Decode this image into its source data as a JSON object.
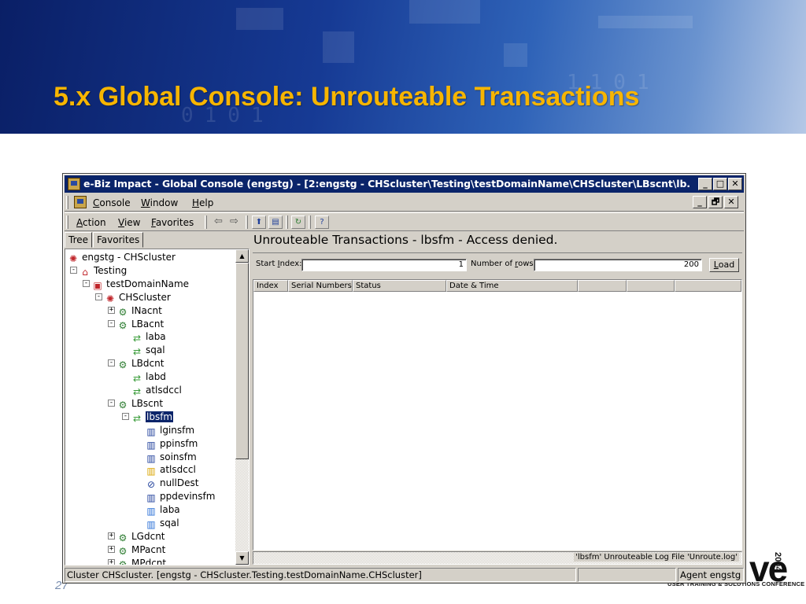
{
  "slide": {
    "title": "5.x Global Console: Unrouteable Transactions",
    "page_number": "27",
    "brand": {
      "mark": "ve",
      "year": "2004",
      "tagline": "USER TRAINING & SOLUTIONS CONFERENCE"
    }
  },
  "window": {
    "title": "e-Biz Impact - Global Console (engstg) - [2:engstg - CHScluster\\Testing\\testDomainName\\CHScluster\\LBscnt\\lb...",
    "controls": {
      "minimize": "_",
      "maximize": "□",
      "close": "✕"
    },
    "child_controls": {
      "minimize": "_",
      "restore": "🗗",
      "close": "✕"
    }
  },
  "menubar": {
    "items": [
      {
        "pre": "",
        "key": "C",
        "post": "onsole"
      },
      {
        "pre": "",
        "key": "W",
        "post": "indow"
      },
      {
        "pre": "",
        "key": "H",
        "post": "elp"
      }
    ]
  },
  "toolbar": {
    "items": [
      {
        "pre": "",
        "key": "A",
        "post": "ction"
      },
      {
        "pre": "",
        "key": "V",
        "post": "iew"
      },
      {
        "pre": "",
        "key": "F",
        "post": "avorites"
      }
    ],
    "back_glyph": "⇦",
    "forward_glyph": "⇨"
  },
  "left_tabs": [
    "Tree",
    "Favorites"
  ],
  "tree": [
    {
      "label": "engstg - CHScluster",
      "icon": "cluster-root-icon",
      "color": "#c0262b",
      "depth": 0,
      "exp": ""
    },
    {
      "label": "Testing",
      "icon": "folder-home-icon",
      "color": "#c0262b",
      "depth": 1,
      "exp": "-"
    },
    {
      "label": "testDomainName",
      "icon": "domain-icon",
      "color": "#c0262b",
      "depth": 2,
      "exp": "-"
    },
    {
      "label": "CHScluster",
      "icon": "cluster-icon",
      "color": "#c0262b",
      "depth": 3,
      "exp": "-"
    },
    {
      "label": "INacnt",
      "icon": "connector-icon",
      "color": "#2e7d32",
      "depth": 4,
      "exp": "+"
    },
    {
      "label": "LBacnt",
      "icon": "connector-icon",
      "color": "#2e7d32",
      "depth": 4,
      "exp": "-"
    },
    {
      "label": "laba",
      "icon": "route-icon",
      "color": "#3a9c3a",
      "depth": 5,
      "exp": ""
    },
    {
      "label": "sqal",
      "icon": "route-icon",
      "color": "#3a9c3a",
      "depth": 5,
      "exp": ""
    },
    {
      "label": "LBdcnt",
      "icon": "connector-icon",
      "color": "#2e7d32",
      "depth": 4,
      "exp": "-"
    },
    {
      "label": "labd",
      "icon": "route-icon",
      "color": "#3a9c3a",
      "depth": 5,
      "exp": ""
    },
    {
      "label": "atlsdccl",
      "icon": "route-icon",
      "color": "#3a9c3a",
      "depth": 5,
      "exp": ""
    },
    {
      "label": "LBscnt",
      "icon": "connector-icon",
      "color": "#2e7d32",
      "depth": 4,
      "exp": "-"
    },
    {
      "label": "lbsfm",
      "icon": "route-icon",
      "color": "#3a9c3a",
      "depth": 5,
      "exp": "-",
      "selected": true
    },
    {
      "label": "lginsfm",
      "icon": "transaction-icon",
      "color": "#1f3f9a",
      "depth": 6,
      "exp": ""
    },
    {
      "label": "ppinsfm",
      "icon": "transaction-icon",
      "color": "#1f3f9a",
      "depth": 6,
      "exp": ""
    },
    {
      "label": "soinsfm",
      "icon": "transaction-icon",
      "color": "#1f3f9a",
      "depth": 6,
      "exp": ""
    },
    {
      "label": "atlsdccl",
      "icon": "transaction-icon",
      "color": "#d9a400",
      "depth": 6,
      "exp": ""
    },
    {
      "label": "nullDest",
      "icon": "null-dest-icon",
      "color": "#1f3f9a",
      "depth": 6,
      "exp": ""
    },
    {
      "label": "ppdevinsfm",
      "icon": "transaction-icon",
      "color": "#1f3f9a",
      "depth": 6,
      "exp": ""
    },
    {
      "label": "laba",
      "icon": "transaction-icon",
      "color": "#2a6fd6",
      "depth": 6,
      "exp": ""
    },
    {
      "label": "sqal",
      "icon": "transaction-icon",
      "color": "#2a6fd6",
      "depth": 6,
      "exp": ""
    },
    {
      "label": "LGdcnt",
      "icon": "connector-icon",
      "color": "#2e7d32",
      "depth": 4,
      "exp": "+"
    },
    {
      "label": "MPacnt",
      "icon": "connector-icon",
      "color": "#2e7d32",
      "depth": 4,
      "exp": "+"
    },
    {
      "label": "MPdcnt",
      "icon": "connector-icon",
      "color": "#2e7d32",
      "depth": 4,
      "exp": "+"
    }
  ],
  "right_pane": {
    "header": "Unrouteable Transactions - lbsfm - Access denied.",
    "start_index_label": {
      "pre": "Start ",
      "key": "I",
      "post": "ndex:"
    },
    "start_index_value": "1",
    "rows_label": {
      "pre": "Number of ",
      "key": "r",
      "post": "ows:"
    },
    "rows_value": "200",
    "load_button": {
      "pre": "",
      "key": "L",
      "post": "oad"
    },
    "columns": [
      "Index",
      "Serial Numbers",
      "Status",
      "Date & Time",
      "",
      "",
      ""
    ],
    "footer": "'lbsfm' Unrouteable Log File 'Unroute.log'"
  },
  "statusbar": {
    "left": "Cluster CHScluster. [engstg - CHScluster.Testing.testDomainName.CHScluster]",
    "middle": "",
    "right": "Agent engstg"
  }
}
